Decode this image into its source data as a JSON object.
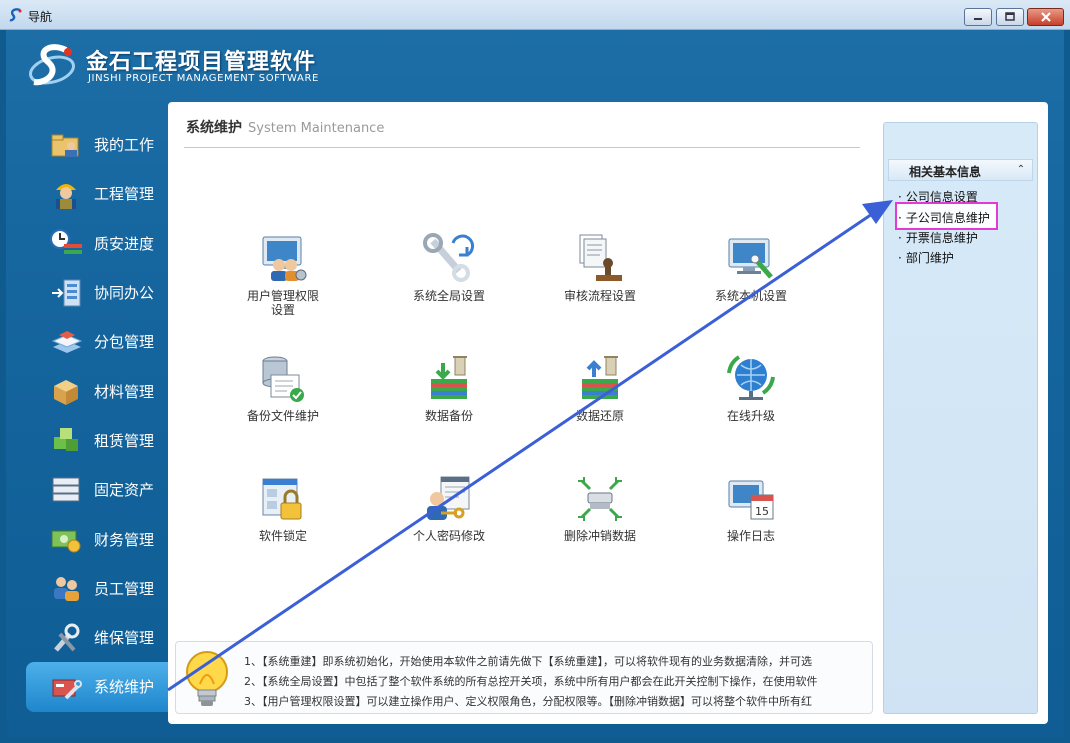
{
  "window": {
    "title": "导航"
  },
  "logo": {
    "title": "金石工程项目管理软件",
    "subtitle": "JINSHI PROJECT MANAGEMENT SOFTWARE"
  },
  "sidebar": {
    "items": [
      {
        "label": "我的工作",
        "icon": "folder-user-icon"
      },
      {
        "label": "工程管理",
        "icon": "worker-icon"
      },
      {
        "label": "质安进度",
        "icon": "clock-bars-icon"
      },
      {
        "label": "协同办公",
        "icon": "office-icon"
      },
      {
        "label": "分包管理",
        "icon": "layers-icon"
      },
      {
        "label": "材料管理",
        "icon": "box-icon"
      },
      {
        "label": "租赁管理",
        "icon": "cubes-icon"
      },
      {
        "label": "固定资产",
        "icon": "server-icon"
      },
      {
        "label": "财务管理",
        "icon": "money-icon"
      },
      {
        "label": "员工管理",
        "icon": "users-icon"
      },
      {
        "label": "维保管理",
        "icon": "tools-icon"
      },
      {
        "label": "系统维护",
        "icon": "maintenance-icon",
        "active": true
      }
    ]
  },
  "panel": {
    "title": "系统维护",
    "title_en": "System Maintenance",
    "tiles": [
      {
        "label_line1": "用户管理权限",
        "label_line2": "设置"
      },
      {
        "label_line1": "系统全局设置",
        "label_line2": ""
      },
      {
        "label_line1": "审核流程设置",
        "label_line2": ""
      },
      {
        "label_line1": "系统本机设置",
        "label_line2": ""
      },
      {
        "label_line1": "备份文件维护",
        "label_line2": ""
      },
      {
        "label_line1": "数据备份",
        "label_line2": ""
      },
      {
        "label_line1": "数据还原",
        "label_line2": ""
      },
      {
        "label_line1": "在线升级",
        "label_line2": ""
      },
      {
        "label_line1": "软件锁定",
        "label_line2": ""
      },
      {
        "label_line1": "个人密码修改",
        "label_line2": ""
      },
      {
        "label_line1": "删除冲销数据",
        "label_line2": ""
      },
      {
        "label_line1": "操作日志",
        "label_line2": ""
      }
    ]
  },
  "rightpanel": {
    "header": "相关基本信息",
    "links": [
      "公司信息设置",
      "子公司信息维护",
      "开票信息维护",
      "部门维护"
    ],
    "highlighted_index": 1
  },
  "tips": {
    "lines": [
      "1、【系统重建】即系统初始化，开始使用本软件之前请先做下【系统重建】，可以将软件现有的业务数据清除，并可选",
      "2、【系统全局设置】中包括了整个软件系统的所有总控开关项，系统中所有用户都会在此开关控制下操作，在使用软件",
      "3、【用户管理权限设置】可以建立操作用户、定义权限角色，分配权限等。【删除冲销数据】可以将整个软件中所有红"
    ]
  },
  "colors": {
    "accent": "#1f86cc",
    "highlight": "#e33ad6",
    "arrow": "#3b5fd6"
  }
}
